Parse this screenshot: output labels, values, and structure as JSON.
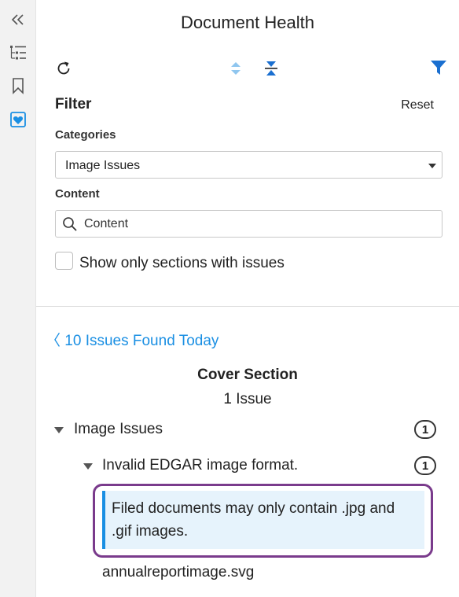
{
  "rail": {
    "icons": [
      "collapse-icon",
      "outline-icon",
      "bookmark-icon",
      "document-health-icon"
    ]
  },
  "header": {
    "title": "Document Health"
  },
  "toolbar": {
    "refresh_icon": "refresh-icon",
    "expand_icon": "expand-all-icon",
    "collapse_icon": "collapse-all-icon",
    "filter_icon": "filter-icon",
    "accent": "#1a8fe3"
  },
  "filter": {
    "heading": "Filter",
    "reset_label": "Reset",
    "categories_label": "Categories",
    "categories_value": "Image Issues",
    "content_label": "Content",
    "content_placeholder": "Content",
    "checkbox_label": "Show only sections with issues"
  },
  "results": {
    "link": "〈 10 Issues Found Today",
    "section_title": "Cover Section",
    "section_count": "1 Issue",
    "category": {
      "label": "Image Issues",
      "count": "1"
    },
    "issue": {
      "label": "Invalid EDGAR image format.",
      "count": "1"
    },
    "message": "Filed documents may only contain .jpg and .gif images.",
    "filename": "annualreportimage.svg"
  }
}
